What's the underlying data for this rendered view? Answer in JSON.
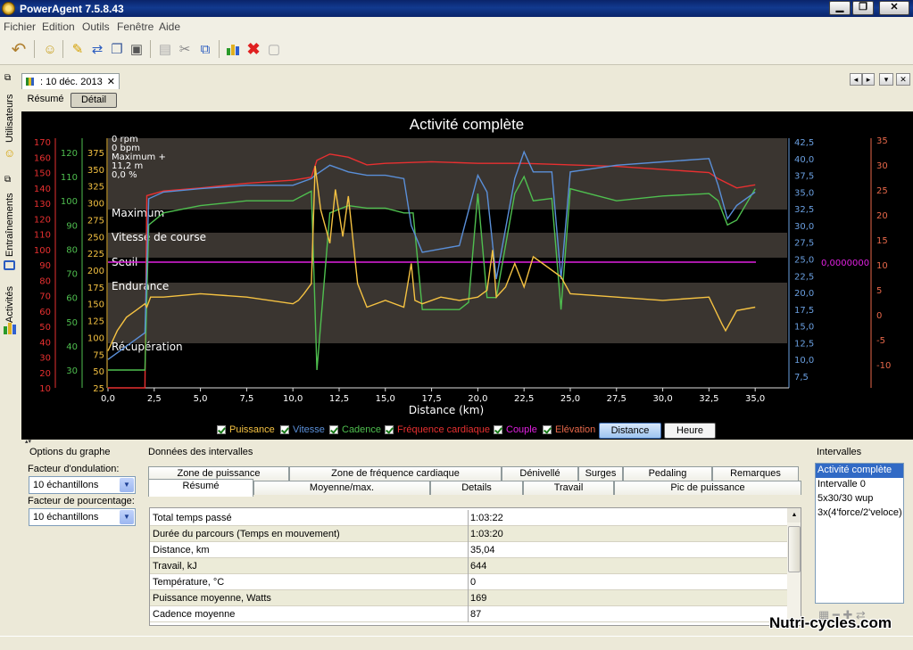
{
  "window": {
    "title": "PowerAgent 7.5.8.43",
    "min_label": "▁",
    "restore_label": "❐",
    "close_label": "✕"
  },
  "menu": [
    "Fichier",
    "Edition",
    "Outils",
    "Fenêtre",
    "Aide"
  ],
  "toolbar_icons": [
    "undo-icon",
    "user-icon",
    "wand-icon",
    "move-icon",
    "copy-icon",
    "paste-icon",
    "cut-icon",
    "export-icon",
    "chart-icon",
    "delete-icon",
    "disabled-icon"
  ],
  "sidebar": {
    "items": [
      {
        "label": "Utilisateurs",
        "icon": "user-icon"
      },
      {
        "label": "Entraînements",
        "icon": "calendar-icon"
      },
      {
        "label": "Activités",
        "icon": "bars-icon"
      }
    ]
  },
  "doc_tab": {
    "label": ": 10 déc. 2013",
    "close": "✕"
  },
  "view_tabs": {
    "resume": "Résumé",
    "detail": "Détail"
  },
  "chart": {
    "title": "Activité complète",
    "xlabel": "Distance (km)",
    "x_ticks": [
      "0,0",
      "2,5",
      "5,0",
      "7,5",
      "10,0",
      "12,5",
      "15,0",
      "17,5",
      "20,0",
      "22,5",
      "25,0",
      "27,5",
      "30,0",
      "32,5",
      "35,0"
    ],
    "axis_hr": [
      "170",
      "160",
      "150",
      "140",
      "130",
      "120",
      "110",
      "100",
      "90",
      "80",
      "70",
      "60",
      "50",
      "40",
      "30",
      "20",
      "10"
    ],
    "axis_cad": [
      "120",
      "110",
      "100",
      "90",
      "80",
      "70",
      "60",
      "50",
      "40",
      "30"
    ],
    "axis_power": [
      "375",
      "350",
      "325",
      "300",
      "275",
      "250",
      "225",
      "200",
      "175",
      "150",
      "125",
      "100",
      "75",
      "50",
      "25"
    ],
    "axis_speed": [
      "42,5",
      "40,0",
      "37,5",
      "35,0",
      "32,5",
      "30,0",
      "27,5",
      "25,0",
      "22,5",
      "20,0",
      "17,5",
      "15,0",
      "12,5",
      "10,0",
      "7,5"
    ],
    "axis_elev": [
      "35",
      "30",
      "25",
      "20",
      "15",
      "10",
      "5",
      "0",
      "-5",
      "-10"
    ],
    "zones": [
      "Maximum",
      "Vitesse de course",
      "Seuil",
      "Endurance",
      "Récupération"
    ],
    "info_lines": [
      "0 rpm",
      "0 bpm",
      "Maximum +",
      "11,2 m",
      "0,0 %"
    ],
    "couple_readout": "0,0000000",
    "colors": {
      "power": "#f5c242",
      "speed": "#5a8fd8",
      "cadence": "#4fbf4f",
      "hr": "#e83030",
      "couple": "#e020e0",
      "elevation": "#e8684a"
    }
  },
  "legend": [
    {
      "label": "Puissance",
      "color": "#f5c242"
    },
    {
      "label": "Vitesse",
      "color": "#5a8fd8"
    },
    {
      "label": "Cadence",
      "color": "#4fbf4f"
    },
    {
      "label": "Fréquence cardiaque",
      "color": "#e83030"
    },
    {
      "label": "Couple",
      "color": "#e020e0"
    },
    {
      "label": "Elévation",
      "color": "#e8684a"
    }
  ],
  "axis_buttons": {
    "distance": "Distance",
    "heure": "Heure"
  },
  "graph_options": {
    "title": "Options du graphe",
    "smoothing_label": "Facteur d'ondulation:",
    "smoothing_value": "10 échantillons",
    "percent_label": "Facteur de pourcentage:",
    "percent_value": "10 échantillons"
  },
  "intervals_data": {
    "title": "Données des intervalles",
    "tabs_row1": [
      "Zone de puissance",
      "Zone de fréquence cardiaque",
      "Dénivellé",
      "Surges",
      "Pedaling",
      "Remarques"
    ],
    "tabs_row2": [
      "Résumé",
      "Moyenne/max.",
      "Details",
      "Travail",
      "Pic de puissance"
    ],
    "rows": [
      {
        "label": "Total temps passé",
        "value": "1:03:22"
      },
      {
        "label": "Durée du parcours (Temps en mouvement)",
        "value": "1:03:20"
      },
      {
        "label": "Distance, km",
        "value": "35,04"
      },
      {
        "label": "Travail, kJ",
        "value": "644"
      },
      {
        "label": "Température, °C",
        "value": "0"
      },
      {
        "label": "Puissance moyenne, Watts",
        "value": "169"
      },
      {
        "label": "Cadence moyenne",
        "value": "87"
      }
    ]
  },
  "intervals": {
    "title": "Intervalles",
    "items": [
      "Activité complète",
      "Intervalle 0",
      "5x30/30 wup",
      "3x(4'force/2'veloce)"
    ]
  },
  "watermark": "Nutri-cycles.com",
  "chart_data": {
    "type": "line",
    "title": "Activité complète",
    "xlabel": "Distance (km)",
    "xlim": [
      0,
      35.04
    ],
    "series": [
      {
        "name": "Puissance",
        "unit": "W",
        "ylim": [
          25,
          385
        ],
        "x": [
          0,
          0.5,
          1,
          1.5,
          2,
          2.1,
          2.3,
          3,
          5,
          7.5,
          10,
          10.3,
          10.6,
          11,
          11.2,
          11.5,
          12,
          12.3,
          12.7,
          13,
          13.5,
          14,
          15,
          16,
          16.4,
          16.6,
          17,
          18,
          19,
          20,
          20.5,
          20.8,
          21,
          21.5,
          22,
          22.5,
          23,
          24,
          24.5,
          25,
          27.5,
          30,
          32.5,
          33.2,
          33.4,
          34,
          35
        ],
        "y": [
          80,
          110,
          130,
          140,
          150,
          145,
          160,
          160,
          165,
          160,
          150,
          155,
          165,
          180,
          355,
          290,
          240,
          320,
          250,
          310,
          180,
          145,
          155,
          145,
          210,
          155,
          150,
          160,
          155,
          160,
          170,
          230,
          160,
          175,
          210,
          175,
          220,
          200,
          190,
          165,
          160,
          155,
          160,
          120,
          110,
          140,
          145
        ]
      },
      {
        "name": "Vitesse",
        "unit": "km/h",
        "ylim": [
          5.5,
          42.5
        ],
        "x": [
          0,
          1,
          2,
          2.2,
          3,
          5,
          7.5,
          10,
          11,
          11.2,
          12,
          13,
          14,
          15,
          16,
          16.4,
          17,
          18,
          19,
          20,
          20.5,
          21,
          22,
          22.5,
          23,
          24,
          24.5,
          25,
          27.5,
          30,
          32.5,
          33,
          33.5,
          34,
          35
        ],
        "y": [
          10,
          12,
          14,
          34,
          35,
          35.5,
          36,
          36,
          37,
          37.5,
          39,
          38,
          37.5,
          37.5,
          37,
          30,
          26,
          26.5,
          27,
          37.5,
          35,
          22,
          37,
          41,
          38,
          38,
          22,
          38,
          39,
          39.5,
          40,
          36,
          31,
          33,
          35
        ]
      },
      {
        "name": "Cadence",
        "unit": "rpm",
        "ylim": [
          25,
          125
        ],
        "x": [
          0,
          2,
          2.2,
          3,
          5,
          7.5,
          10,
          10.5,
          11,
          11.3,
          12,
          13,
          14,
          15,
          16,
          16.5,
          17,
          18,
          19,
          19.5,
          20,
          20.5,
          21,
          22,
          22.5,
          23,
          24,
          24.5,
          25,
          27.5,
          30,
          32.5,
          33,
          33.5,
          34,
          35
        ],
        "y": [
          30,
          30,
          90,
          95,
          98,
          100,
          100,
          102,
          104,
          30,
          95,
          98,
          97,
          97,
          95,
          95,
          55,
          55,
          55,
          58,
          103,
          60,
          60,
          103,
          110,
          100,
          101,
          55,
          105,
          100,
          102,
          103,
          100,
          90,
          92,
          105
        ]
      },
      {
        "name": "Fréquence cardiaque",
        "unit": "bpm",
        "ylim": [
          5,
          175
        ],
        "x": [
          0,
          2,
          2.1,
          3,
          5,
          7.5,
          10,
          11,
          11.3,
          12,
          13,
          14,
          15,
          17.5,
          20,
          22.5,
          25,
          27.5,
          30,
          32.5,
          33,
          34,
          35
        ],
        "y": [
          10,
          10,
          135,
          138,
          140,
          143,
          145,
          147,
          158,
          162,
          160,
          155,
          156,
          157,
          156,
          156,
          155,
          154,
          152,
          150,
          146,
          140,
          142
        ]
      },
      {
        "name": "Couple",
        "unit": "N·m",
        "ylim": [
          -1,
          1
        ],
        "x": [
          0,
          35.04
        ],
        "y": [
          0,
          0
        ]
      },
      {
        "name": "Elévation",
        "unit": "m",
        "ylim": [
          -15,
          35
        ],
        "x": [
          0,
          5,
          7.5,
          10,
          15,
          20,
          25,
          30,
          35
        ],
        "y": [
          0,
          0,
          0,
          0,
          0,
          0,
          0,
          0,
          0
        ]
      }
    ],
    "zones": [
      "Maximum",
      "Vitesse de course",
      "Seuil",
      "Endurance",
      "Récupération"
    ]
  }
}
